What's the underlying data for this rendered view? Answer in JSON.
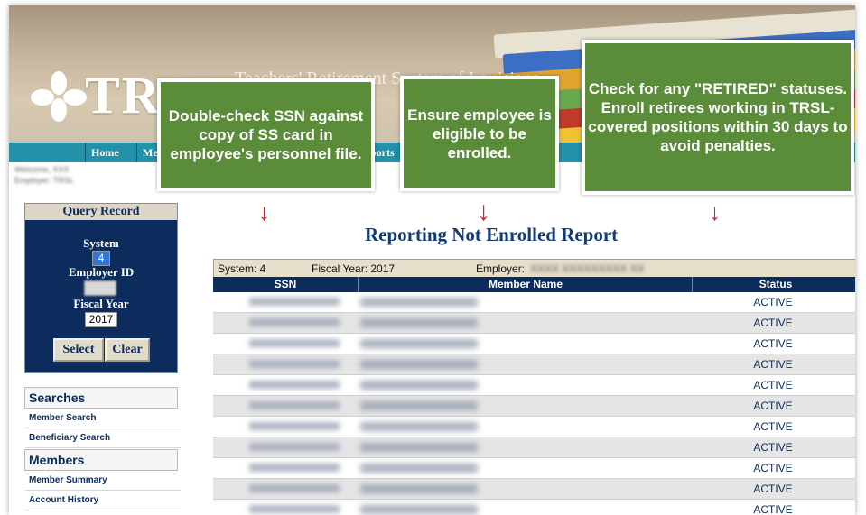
{
  "header": {
    "logo_text": "TRSL",
    "subtitle": "Teachers' Retirement System of Louisiana"
  },
  "nav": {
    "items": [
      "Home",
      "Me",
      "ports"
    ]
  },
  "query": {
    "title": "Query Record",
    "system_label": "System",
    "system_value": "4",
    "employer_label": "Employer ID",
    "fiscal_label": "Fiscal Year",
    "fiscal_value": "2017",
    "select_label": "Select",
    "clear_label": "Clear"
  },
  "menu": {
    "searches_heading": "Searches",
    "member_search": "Member Search",
    "beneficiary_search": "Beneficiary Search",
    "members_heading": "Members",
    "member_summary": "Member Summary",
    "account_history": "Account History"
  },
  "report": {
    "title": "Reporting Not Enrolled Report",
    "system_text": "System: 4",
    "fiscal_text": "Fiscal Year: 2017",
    "employer_label": "Employer:",
    "columns": [
      "SSN",
      "Member Name",
      "Status"
    ],
    "rows": [
      "ACTIVE",
      "ACTIVE",
      "ACTIVE",
      "ACTIVE",
      "ACTIVE",
      "ACTIVE",
      "ACTIVE",
      "ACTIVE",
      "ACTIVE",
      "ACTIVE",
      "ACTIVE"
    ]
  },
  "callouts": {
    "ssn": "Double-check SSN against copy of SS card in employee's personnel file.",
    "eligible": "Ensure employee is eligible to be enrolled.",
    "retired": "Check for any \"RETIRED\" statuses. Enroll retirees working in TRSL-covered positions within 30 days to avoid penalties."
  },
  "colors": {
    "accent": "#0b2c5c",
    "nav": "#2391a8",
    "callout": "#5b8c3a",
    "arrow": "#d3262b"
  }
}
